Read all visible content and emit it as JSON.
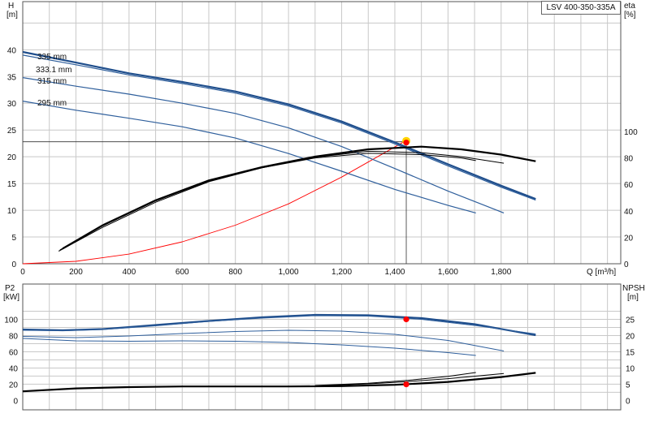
{
  "chart_title": "LSV 400-350-335A",
  "chart_data": [
    {
      "type": "line",
      "title": "LSV 400-350-335A",
      "xlabel": "Q [m³/h]",
      "ylabel": "H\n[m]",
      "y2label": "eta\n[%]",
      "xlim": [
        0,
        2250
      ],
      "ylim": [
        0,
        49
      ],
      "y2lim": [
        0,
        100
      ],
      "x_ticks": [
        "0",
        "200",
        "400",
        "600",
        "800",
        "1,000",
        "1,200",
        "1,400",
        "1,600",
        "1,800"
      ],
      "y_ticks": [
        "0",
        "5",
        "10",
        "15",
        "20",
        "25",
        "30",
        "35",
        "40"
      ],
      "y2_ticks": [
        "0",
        "20",
        "40",
        "60",
        "80",
        "100"
      ],
      "grid": true,
      "head_series": [
        {
          "name": "335 mm",
          "color": "#1f4e8c",
          "width": 2.2,
          "x": [
            0,
            200,
            400,
            600,
            800,
            1000,
            1200,
            1400,
            1600,
            1800,
            1930
          ],
          "y": [
            39.6,
            37.6,
            35.6,
            34.0,
            32.2,
            29.8,
            26.6,
            22.7,
            18.6,
            14.6,
            12.1
          ]
        },
        {
          "name": "333.1 mm",
          "color": "#2f5f9c",
          "width": 1.2,
          "x": [
            0,
            200,
            400,
            600,
            800,
            1000,
            1200,
            1400,
            1600,
            1800,
            1930
          ],
          "y": [
            39.0,
            37.2,
            35.3,
            33.7,
            31.9,
            29.5,
            26.3,
            22.4,
            18.3,
            14.3,
            11.9
          ]
        },
        {
          "name": "315 mm",
          "color": "#2f5f9c",
          "width": 1.2,
          "x": [
            0,
            200,
            400,
            600,
            800,
            1000,
            1200,
            1400,
            1600,
            1810
          ],
          "y": [
            34.8,
            33.2,
            31.7,
            30.0,
            28.1,
            25.4,
            21.9,
            17.8,
            13.6,
            9.5
          ]
        },
        {
          "name": "295 mm",
          "color": "#2f5f9c",
          "width": 1.2,
          "x": [
            0,
            200,
            400,
            600,
            800,
            1000,
            1200,
            1400,
            1600,
            1705
          ],
          "y": [
            30.4,
            28.7,
            27.2,
            25.6,
            23.5,
            20.6,
            17.3,
            13.9,
            10.9,
            9.5
          ]
        }
      ],
      "eta_series": [
        {
          "name": "",
          "color": "#000000",
          "width": 2.2,
          "x": [
            150,
            300,
            500,
            700,
            900,
            1100,
            1300,
            1500,
            1650,
            1800,
            1930
          ],
          "y": [
            11.5,
            29.0,
            48.0,
            63.0,
            73.0,
            81.0,
            86.5,
            88.5,
            86.5,
            82.5,
            77.5
          ]
        },
        {
          "name": "",
          "color": "#000000",
          "width": 1.0,
          "x": [
            135,
            300,
            500,
            700,
            900,
            1100,
            1300,
            1500,
            1650,
            1810
          ],
          "y": [
            9.5,
            27.5,
            46.5,
            62.0,
            72.5,
            80.5,
            85.0,
            84.0,
            81.0,
            76.0
          ]
        },
        {
          "name": "",
          "color": "#000000",
          "width": 1.0,
          "x": [
            140,
            300,
            500,
            700,
            900,
            1100,
            1300,
            1500,
            1650,
            1705
          ],
          "y": [
            10.5,
            28.5,
            47.5,
            62.5,
            72.5,
            80.0,
            83.5,
            82.5,
            80.0,
            78.0
          ]
        }
      ],
      "system_curve": {
        "color": "#ff0000",
        "x": [
          0,
          200,
          400,
          600,
          800,
          1000,
          1200,
          1445
        ],
        "y": [
          0,
          0.45,
          1.8,
          4.1,
          7.2,
          11.2,
          16.2,
          23.1
        ]
      },
      "duty_point": {
        "x": 1443,
        "y": 22.8
      },
      "duty_marker_color": "#ff0000",
      "duty_glow_color": "#ffd400"
    },
    {
      "type": "line",
      "xlabel": "",
      "ylabel": "P2\n[kW]",
      "y2label": "NPSH\n[m]",
      "xlim": [
        0,
        2250
      ],
      "ylim": [
        0,
        130
      ],
      "y2lim": [
        0,
        32.5
      ],
      "y_ticks": [
        "0",
        "20",
        "40",
        "60",
        "80",
        "100"
      ],
      "y2_ticks": [
        "0",
        "5",
        "10",
        "15",
        "20",
        "25"
      ],
      "grid": true,
      "power_series": [
        {
          "name": "",
          "color": "#1f4e8c",
          "width": 2.2,
          "x": [
            0,
            150,
            300,
            500,
            700,
            900,
            1100,
            1300,
            1500,
            1700,
            1930
          ],
          "y": [
            87.5,
            86.5,
            88.0,
            93.0,
            98.0,
            102.5,
            105.5,
            105.0,
            101.5,
            94.0,
            80.5
          ]
        },
        {
          "name": "",
          "color": "#2f5f9c",
          "width": 1.0,
          "x": [
            0,
            150,
            300,
            500,
            700,
            900,
            1100,
            1300,
            1500,
            1700,
            1930
          ],
          "y": [
            86.5,
            86.0,
            87.5,
            92.0,
            97.5,
            101.5,
            104.5,
            104.0,
            100.0,
            92.5,
            82.0
          ]
        },
        {
          "name": "",
          "color": "#2f5f9c",
          "width": 1.0,
          "x": [
            0,
            200,
            400,
            600,
            800,
            1000,
            1200,
            1400,
            1600,
            1810
          ],
          "y": [
            79.0,
            77.5,
            79.5,
            82.5,
            85.0,
            86.5,
            85.5,
            81.5,
            74.0,
            61.0
          ]
        },
        {
          "name": "",
          "color": "#2f5f9c",
          "width": 1.0,
          "x": [
            0,
            200,
            400,
            600,
            800,
            1000,
            1200,
            1400,
            1600,
            1705
          ],
          "y": [
            76.5,
            73.5,
            73.0,
            73.5,
            73.0,
            71.5,
            68.5,
            64.5,
            59.0,
            55.5
          ]
        }
      ],
      "npsh_series": [
        {
          "name": "",
          "color": "#000000",
          "width": 2.2,
          "x": [
            0,
            200,
            400,
            600,
            800,
            1000,
            1200,
            1400,
            1600,
            1800,
            1930
          ],
          "y": [
            2.8,
            3.7,
            4.1,
            4.3,
            4.3,
            4.3,
            4.4,
            4.8,
            5.7,
            7.2,
            8.5
          ]
        },
        {
          "name": "",
          "color": "#000000",
          "width": 1.0,
          "x": [
            1100,
            1300,
            1450,
            1600,
            1810
          ],
          "y": [
            4.4,
            5.1,
            5.8,
            6.7,
            8.3
          ]
        },
        {
          "name": "",
          "color": "#000000",
          "width": 1.0,
          "x": [
            1100,
            1300,
            1450,
            1600,
            1705
          ],
          "y": [
            4.6,
            5.3,
            6.2,
            7.4,
            8.6
          ]
        }
      ],
      "duty_points": [
        {
          "x": 1443,
          "y": 100.0
        },
        {
          "x": 1443,
          "y": 19.8
        }
      ]
    }
  ]
}
